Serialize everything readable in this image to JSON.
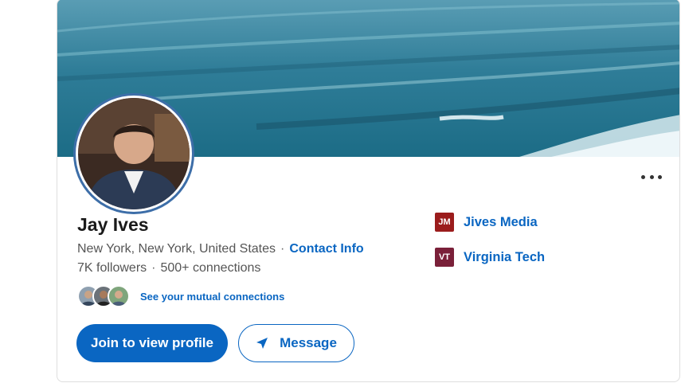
{
  "profile": {
    "name": "Jay Ives",
    "location": "New York, New York, United States",
    "contact_label": "Contact Info",
    "followers": "7K followers",
    "connections": "500+ connections",
    "mutual_link": "See your mutual connections"
  },
  "actions": {
    "join_label": "Join to view profile",
    "message_label": "Message"
  },
  "organizations": [
    {
      "name": "Jives Media",
      "logo_text": "JM",
      "logo_color": "#9b1c1c"
    },
    {
      "name": "Virginia Tech",
      "logo_text": "VT",
      "logo_color": "#7a2039"
    }
  ],
  "colors": {
    "accent": "#0a66c2",
    "avatar_ring": "#3d6ea8"
  },
  "icons": {
    "more": "more-horizontal-icon",
    "message": "send-arrow-icon"
  }
}
